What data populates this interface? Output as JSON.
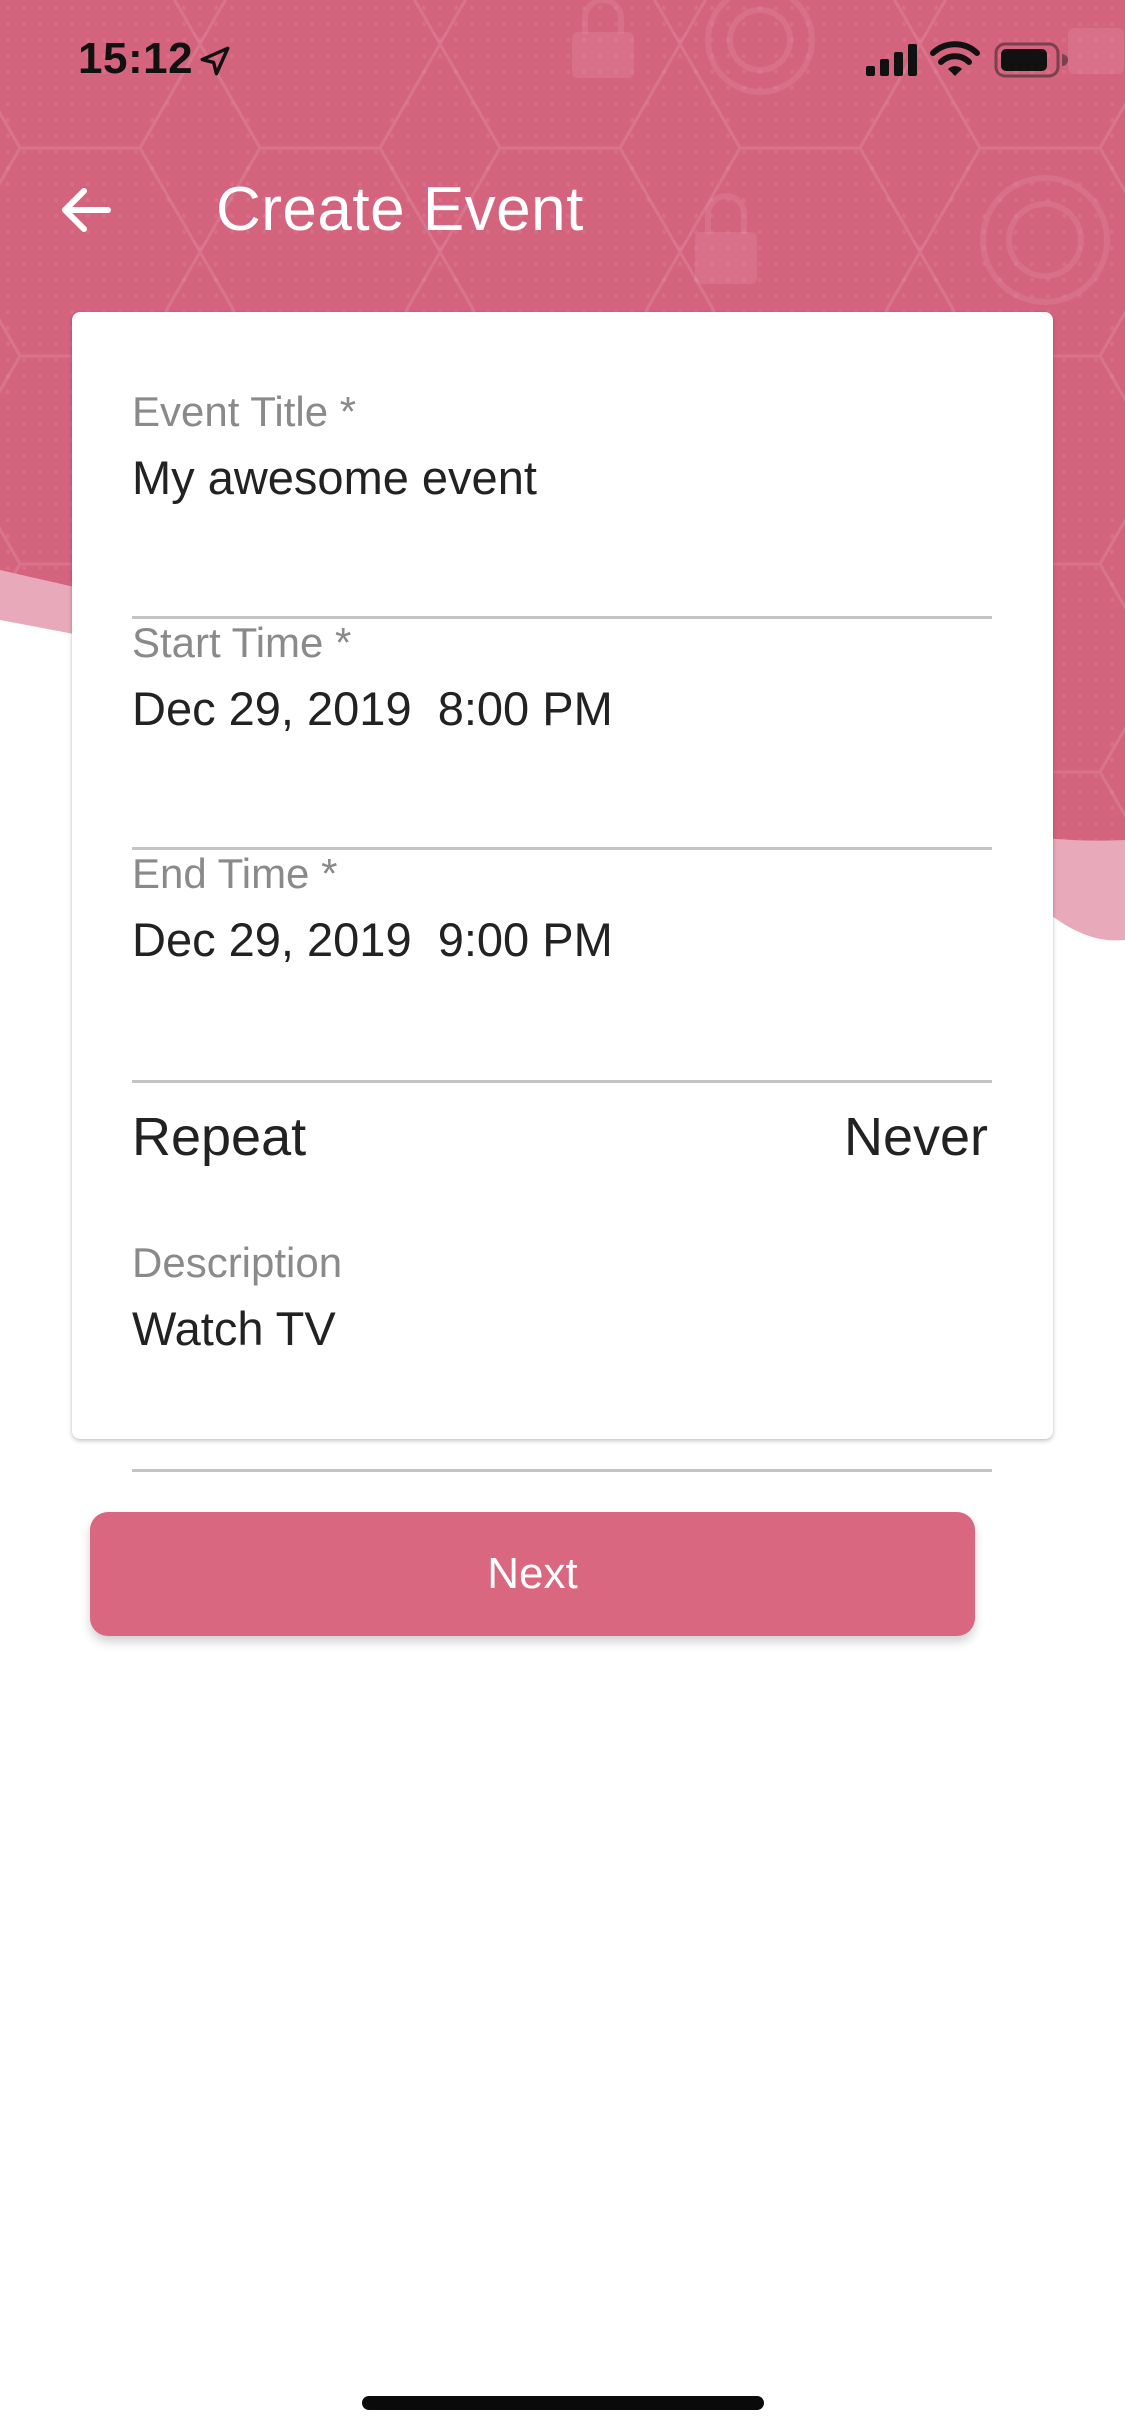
{
  "status_bar": {
    "time": "15:12",
    "icons": [
      "location-arrow-icon",
      "cellular-signal-icon",
      "wifi-icon",
      "battery-icon"
    ]
  },
  "header": {
    "title": "Create Event",
    "back_icon": "arrow-left-icon",
    "background_color": "#d4647e",
    "accent_light_color": "#e8aabb"
  },
  "form": {
    "event_title": {
      "label": "Event Title *",
      "value": "My awesome event"
    },
    "start_time": {
      "label": "Start Time *",
      "value": "Dec 29, 2019  8:00 PM"
    },
    "end_time": {
      "label": "End Time *",
      "value": "Dec 29, 2019  9:00 PM"
    },
    "repeat": {
      "label": "Repeat",
      "value": "Never"
    },
    "description": {
      "label": "Description",
      "value": "Watch TV"
    }
  },
  "next_button": {
    "label": "Next",
    "color": "#d9677f"
  }
}
